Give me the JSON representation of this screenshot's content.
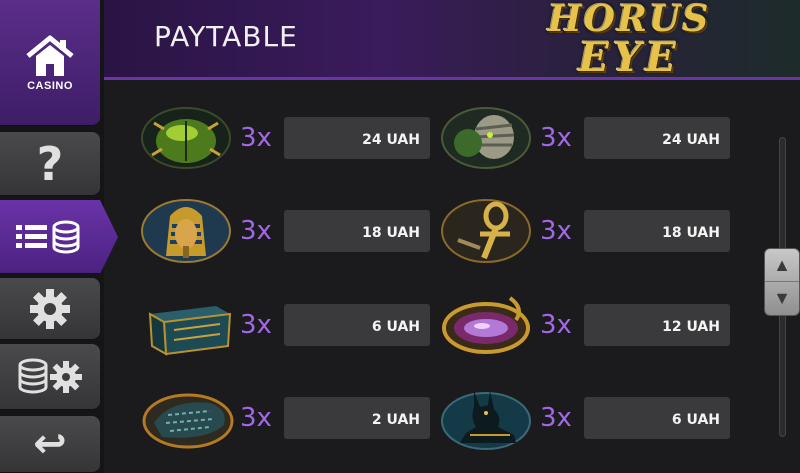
{
  "header": {
    "title": "PAYTABLE",
    "logo_line1": "HORUS",
    "logo_line2": "EYE"
  },
  "sidebar": {
    "casino_label": "CASINO",
    "help_glyph": "?",
    "back_glyph": "↩"
  },
  "paytable": {
    "left": [
      {
        "symbol": "scarab",
        "multiplier": "3x",
        "payout": "24 UAH"
      },
      {
        "symbol": "pharaoh",
        "multiplier": "3x",
        "payout": "18 UAH"
      },
      {
        "symbol": "treasure-chest",
        "multiplier": "3x",
        "payout": "6 UAH"
      },
      {
        "symbol": "stone-tablet",
        "multiplier": "3x",
        "payout": "2 UAH"
      }
    ],
    "right": [
      {
        "symbol": "mummy",
        "multiplier": "3x",
        "payout": "24 UAH"
      },
      {
        "symbol": "ankh",
        "multiplier": "3x",
        "payout": "18 UAH"
      },
      {
        "symbol": "amulet",
        "multiplier": "3x",
        "payout": "12 UAH"
      },
      {
        "symbol": "anubis",
        "multiplier": "3x",
        "payout": "6 UAH"
      }
    ]
  },
  "scroll": {
    "up_glyph": "▲",
    "down_glyph": "▼"
  },
  "colors": {
    "accent": "#6a33a8",
    "multiplier": "#a267e6",
    "gold": "#e6c24a"
  }
}
